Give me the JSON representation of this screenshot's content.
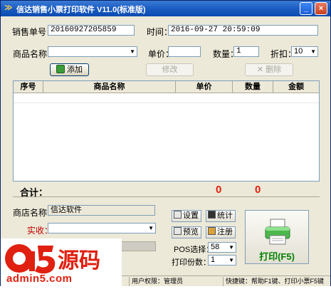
{
  "window": {
    "title": "信达销售小票打印软件 V11.0(标准版)",
    "minimize": "_",
    "close": "×"
  },
  "form": {
    "order_no_label": "销售单号：",
    "order_no": "20160927205859",
    "time_label": "时间：",
    "time": "2016-09-27  20:59:09",
    "product_label": "商品名称：",
    "product_value": "",
    "price_label": "单价：",
    "price_value": "",
    "qty_label": "数量：",
    "qty_value": "1",
    "discount_label": "折扣：",
    "discount_value": "10"
  },
  "actions": {
    "add": "添加",
    "edit": "修改",
    "delete": "删除"
  },
  "table": {
    "columns": [
      "序号",
      "商品名称",
      "单价",
      "数量",
      "金额"
    ]
  },
  "totals": {
    "label": "合计：",
    "quantity": "0",
    "amount": "0"
  },
  "bottom": {
    "shop_label": "商店名称：",
    "shop_name": "信达软件",
    "received_label": "实收：",
    "received_value": "",
    "settings": "设置",
    "stats": "统计",
    "preview": "预览",
    "register": "注册",
    "pos_label": "POS选择：",
    "pos_value": "58",
    "copies_label": "打印份数：",
    "copies_value": "1",
    "print": "打印(F5)"
  },
  "status": {
    "permission": "用户权限：管理员",
    "hotkeys": "快捷键：帮助F1键、打印小票F5键"
  },
  "watermark": {
    "brand": "a5源码",
    "site": "admin5.com"
  },
  "colors": {
    "title_bar": "#1e5fc4",
    "total_red": "#e02010",
    "print_green": "#008000"
  }
}
